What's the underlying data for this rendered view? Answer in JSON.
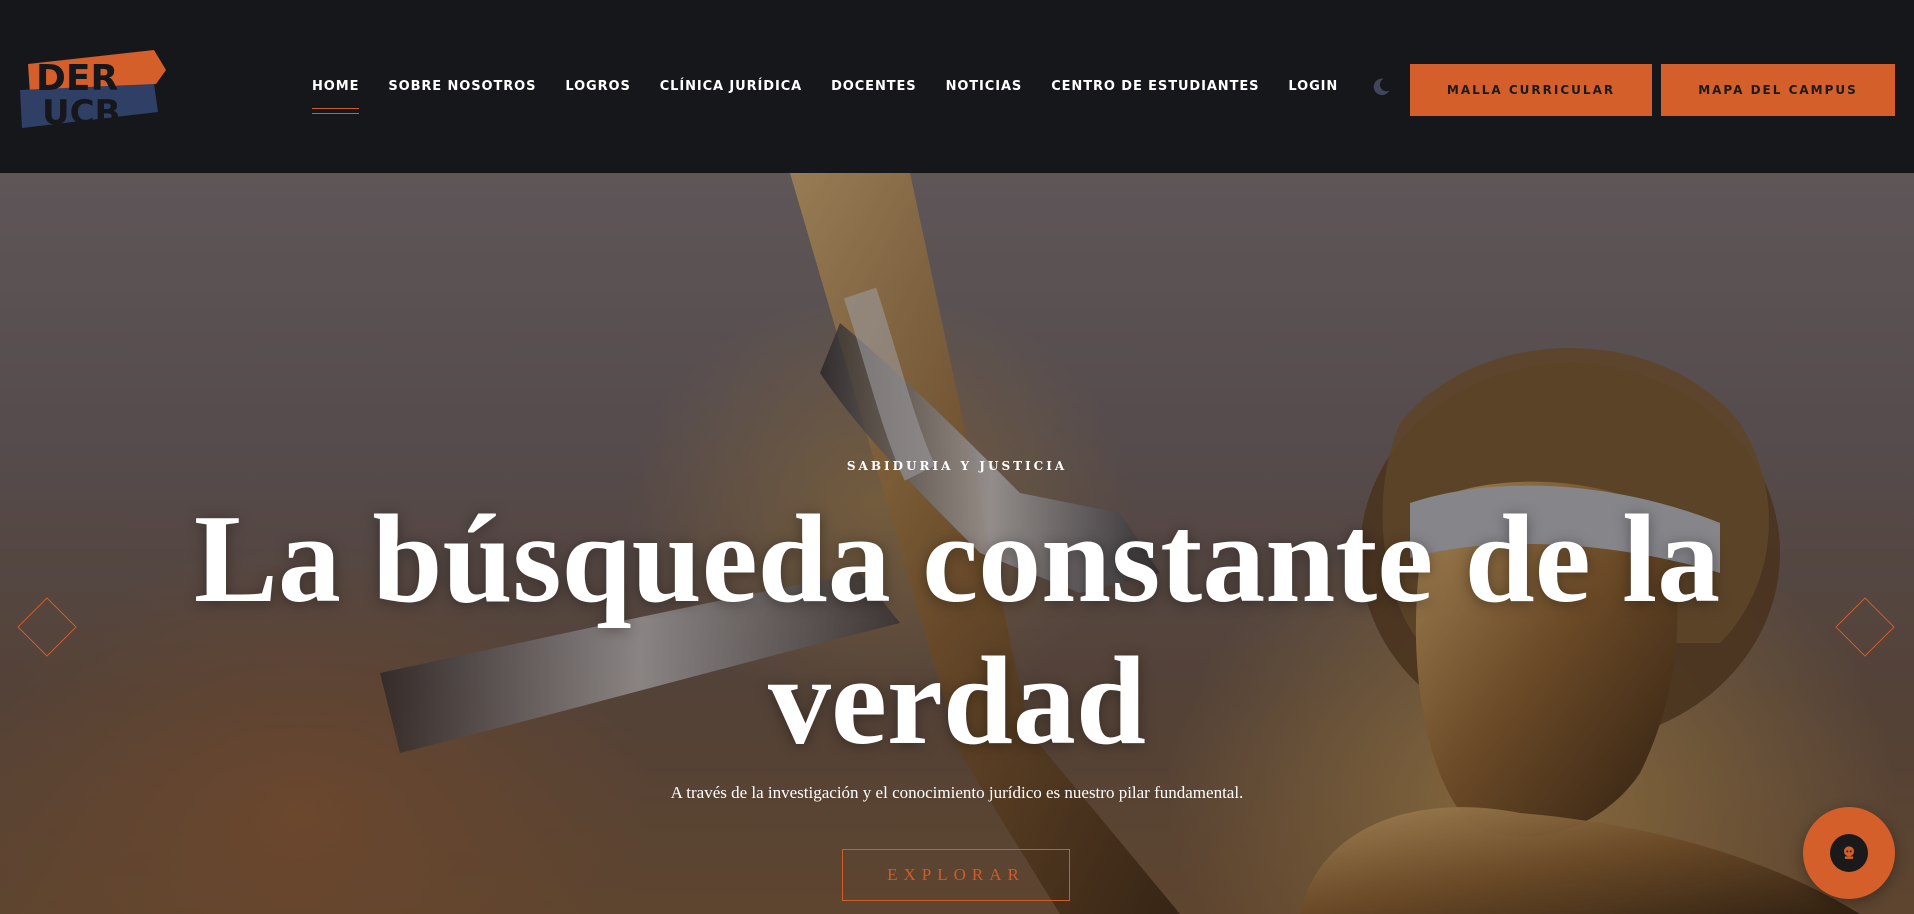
{
  "logo": {
    "line1": "DER",
    "line2": "UCB",
    "color_primary": "#d45f2a",
    "color_secondary": "#2f3f66"
  },
  "nav": {
    "items": [
      {
        "label": "HOME",
        "active": true
      },
      {
        "label": "SOBRE NOSOTROS"
      },
      {
        "label": "LOGROS"
      },
      {
        "label": "CLÍNICA JURÍDICA"
      },
      {
        "label": "DOCENTES"
      },
      {
        "label": "NOTICIAS"
      },
      {
        "label": "CENTRO DE ESTUDIANTES"
      },
      {
        "label": "LOGIN"
      }
    ],
    "theme_toggle_icon": "moon-icon"
  },
  "buttons": {
    "malla": "MALLA CURRICULAR",
    "mapa": "MAPA DEL CAMPUS"
  },
  "hero": {
    "kicker": "SABIDURIA Y JUSTICIA",
    "headline_line1": "La búsqueda constante de la",
    "headline_line2": "verdad",
    "lead": "A través de la investigación y el conocimiento jurídico es nuestro pilar fundamental.",
    "cta": "EXPLORAR",
    "prev_icon": "diamond-arrow-left-icon",
    "next_icon": "diamond-arrow-right-icon"
  },
  "chat": {
    "icon": "chatbot-icon"
  },
  "colors": {
    "accent": "#d45f2a",
    "header_bg": "#16171b"
  }
}
